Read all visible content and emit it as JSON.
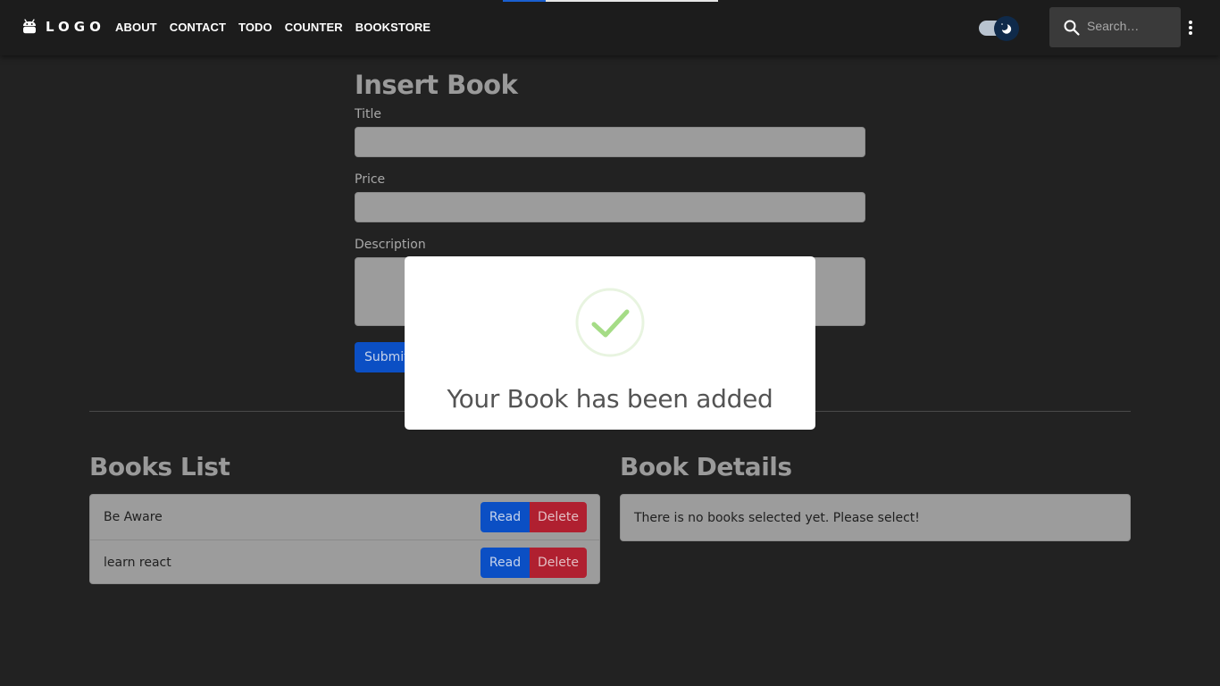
{
  "navbar": {
    "brand": "LOGO",
    "links": [
      "ABOUT",
      "CONTACT",
      "TODO",
      "COUNTER",
      "BOOKSTORE"
    ],
    "search_placeholder": "Search…",
    "theme_toggle": "dark"
  },
  "progress": {
    "fraction": 0.2
  },
  "insert_form": {
    "title": "Insert Book",
    "title_label": "Title",
    "price_label": "Price",
    "description_label": "Description",
    "submit_label": "Submit"
  },
  "books_list": {
    "title": "Books List",
    "items": [
      {
        "name": "Be Aware",
        "read_label": "Read",
        "delete_label": "Delete"
      },
      {
        "name": "learn react",
        "read_label": "Read",
        "delete_label": "Delete"
      }
    ]
  },
  "book_details": {
    "title": "Book Details",
    "empty_text": "There is no books selected yet. Please select!"
  },
  "modal": {
    "message": "Your Book has been added",
    "icon": "success-check-icon"
  },
  "colors": {
    "background": "#222222",
    "navbar": "#1c1c1c",
    "primary": "#0b4fc4",
    "danger": "#b02030",
    "success": "#a5dc86"
  }
}
